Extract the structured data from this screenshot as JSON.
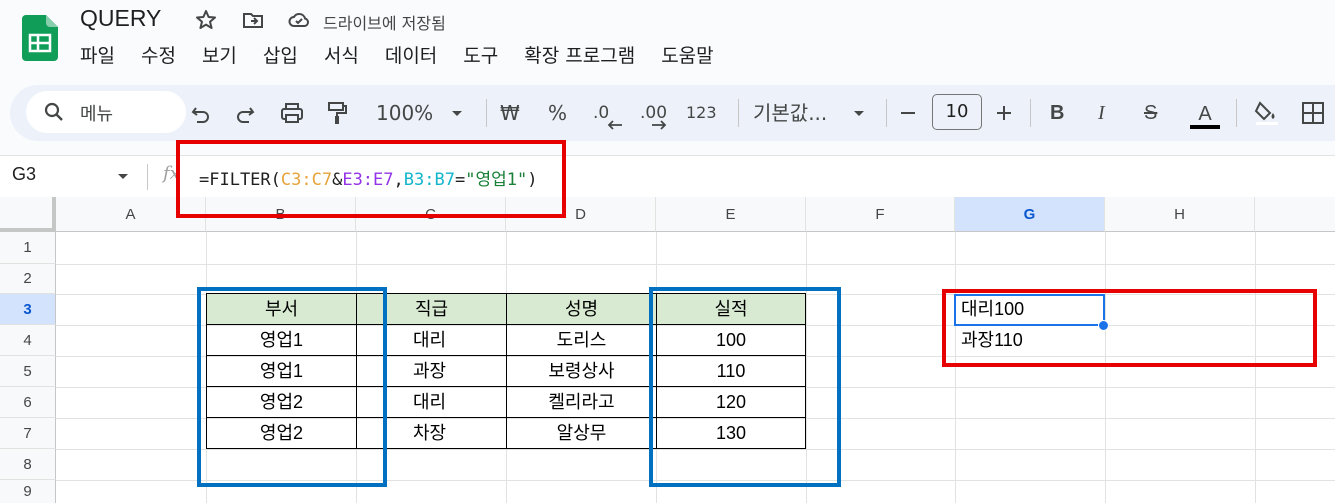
{
  "app": {
    "doc_title": "QUERY",
    "save_status": "드라이브에 저장됨",
    "menu": [
      "파일",
      "수정",
      "보기",
      "삽입",
      "서식",
      "데이터",
      "도구",
      "확장 프로그램",
      "도움말"
    ]
  },
  "toolbar": {
    "search_label": "메뉴",
    "zoom": "100%",
    "currency": "₩",
    "percent": "%",
    "dec_decrease": ".0",
    "dec_increase": ".00",
    "number_format": "123",
    "font_name": "기본값...",
    "font_size": "10",
    "bold": "B",
    "italic": "I",
    "strike": "S",
    "text_color_label": "A",
    "colors": {
      "text_color_bar": "#000000",
      "accent": "#0b57d0"
    }
  },
  "formula_bar": {
    "name_box": "G3",
    "fx": "fx",
    "formula_parts": [
      {
        "text": "=FILTER(",
        "color": "#1f1f1f"
      },
      {
        "text": "C3:C7",
        "color": "#e8a33d"
      },
      {
        "text": "&",
        "color": "#1f1f1f"
      },
      {
        "text": "E3:E7",
        "color": "#9334e6"
      },
      {
        "text": ",",
        "color": "#1f1f1f"
      },
      {
        "text": "B3:B7",
        "color": "#12b5cb"
      },
      {
        "text": "=",
        "color": "#1f1f1f"
      },
      {
        "text": "\"영업1\"",
        "color": "#188038"
      },
      {
        "text": ")",
        "color": "#1f1f1f"
      }
    ]
  },
  "grid": {
    "columns": [
      "A",
      "B",
      "C",
      "D",
      "E",
      "F",
      "G",
      "H"
    ],
    "rows": [
      "1",
      "2",
      "3",
      "4",
      "5",
      "6",
      "7",
      "8",
      "9"
    ],
    "selected_column": "G",
    "selected_row": "3",
    "table": {
      "headers": [
        "부서",
        "직급",
        "성명",
        "실적"
      ],
      "rows": [
        [
          "영업1",
          "대리",
          "도리스",
          "100"
        ],
        [
          "영업1",
          "과장",
          "보령상사",
          "110"
        ],
        [
          "영업2",
          "대리",
          "켈리라고",
          "120"
        ],
        [
          "영업2",
          "차장",
          "알상무",
          "130"
        ]
      ]
    },
    "result_cells": [
      "대리100",
      "과장110"
    ]
  },
  "annotation_colors": {
    "red": "#e60000",
    "blue": "#0070c0"
  }
}
